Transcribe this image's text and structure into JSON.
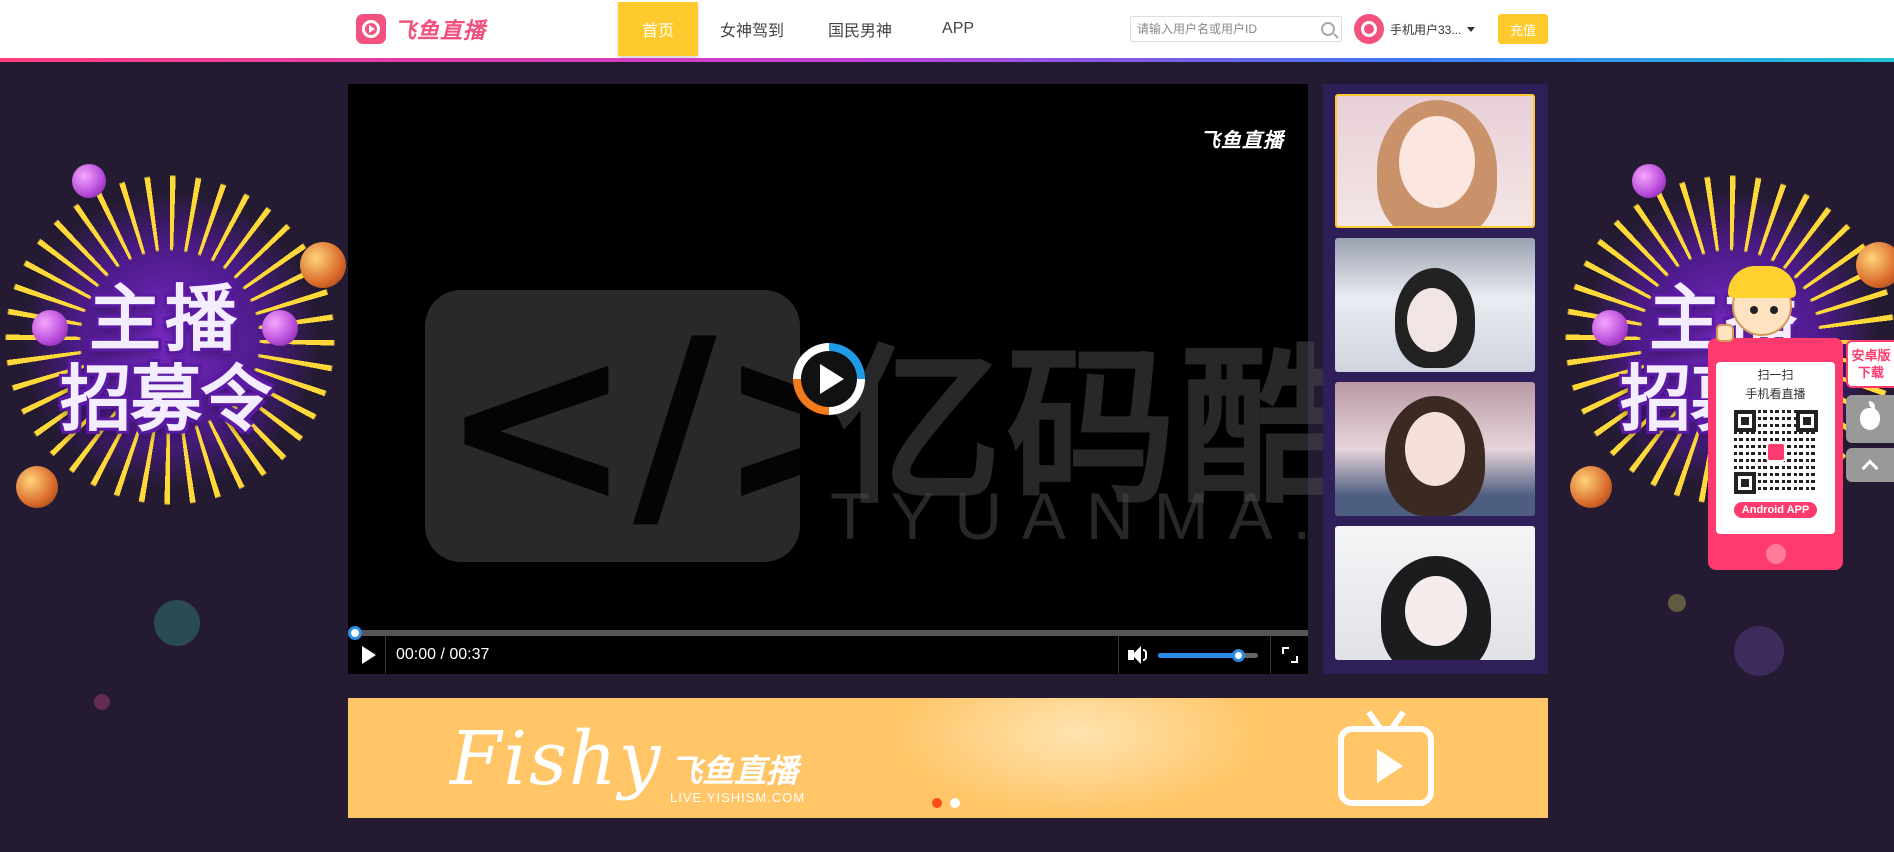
{
  "header": {
    "logo_text": "飞鱼直播",
    "nav": [
      {
        "label": "首页",
        "active": true
      },
      {
        "label": "女神驾到",
        "active": false
      },
      {
        "label": "国民男神",
        "active": false
      },
      {
        "label": "APP",
        "active": false
      }
    ],
    "search_placeholder": "请输入用户名或用户ID",
    "user_name": "手机用户33...",
    "recharge_label": "充值",
    "accent_color": "#ffca2d",
    "brand_color": "#f2527d"
  },
  "side_banner": {
    "line1": "主播",
    "line2": "招募令"
  },
  "player": {
    "brand_label": "飞鱼直播",
    "watermark_cn": "亿码酷站",
    "watermark_en": "TYUANMA.",
    "watermark_glyph": "</>",
    "time_display": "00:00 / 00:37",
    "progress": 0,
    "volume": 0.8
  },
  "thumbnails": [
    {
      "active": true
    },
    {
      "active": false
    },
    {
      "active": false
    },
    {
      "active": false
    }
  ],
  "ad_banner": {
    "brand_en": "Fishy",
    "brand_cn": "飞鱼直播",
    "url_text": "LIVE.YISHISM.COM",
    "slide_count": 2,
    "active_slide": 0
  },
  "qr_card": {
    "line1": "扫一扫",
    "line2": "手机看直播",
    "button_label": "Android APP"
  },
  "side_tabs": {
    "android_line1": "安卓版",
    "android_line2": "下载"
  }
}
